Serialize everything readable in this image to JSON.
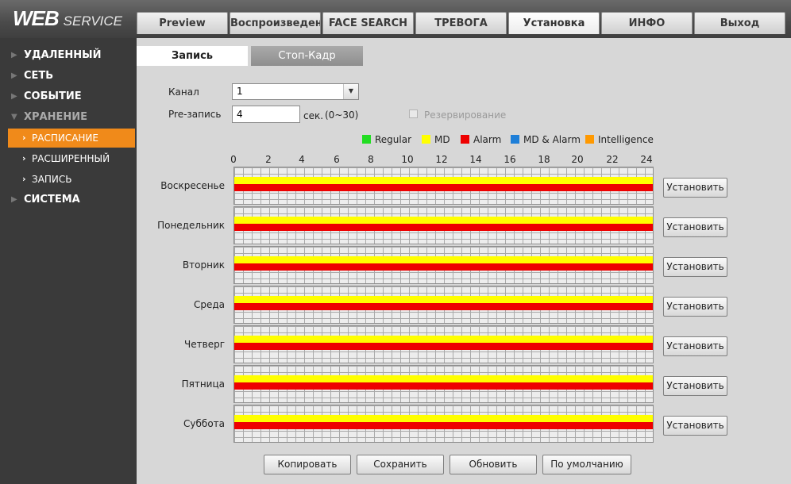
{
  "header": {
    "logo_main": "WEB",
    "logo_sub": "SERVICE",
    "tabs": [
      {
        "label": "Preview"
      },
      {
        "label": "Воспроизведение"
      },
      {
        "label": "FACE SEARCH"
      },
      {
        "label": "ТРЕВОГА"
      },
      {
        "label": "Установка"
      },
      {
        "label": "ИНФО"
      },
      {
        "label": "Выход"
      }
    ],
    "active_tab": "Установка"
  },
  "sidebar": {
    "items": [
      {
        "label": "УДАЛЕННЫЙ"
      },
      {
        "label": "СЕТЬ"
      },
      {
        "label": "СОБЫТИЕ"
      },
      {
        "label": "ХРАНЕНИЕ"
      },
      {
        "label": "СИСТЕМА"
      }
    ],
    "subitems": [
      {
        "label": "РАСПИСАНИЕ"
      },
      {
        "label": "РАСШИРЕННЫЙ"
      },
      {
        "label": "ЗАПИСЬ"
      }
    ],
    "active_subitem": "РАСПИСАНИЕ"
  },
  "subtabs": [
    {
      "label": "Запись"
    },
    {
      "label": "Стоп-Кадр"
    }
  ],
  "form": {
    "channel_label": "Канал",
    "channel_value": "1",
    "prerecord_label": "Pre-запись",
    "prerecord_value": "4",
    "prerecord_unit": "сек.",
    "prerecord_range": "(0~30)",
    "reserve_label": "Резервирование",
    "reserve_checked": false
  },
  "legend": [
    {
      "label": "Regular",
      "color": "#22dd22"
    },
    {
      "label": "MD",
      "color": "#ffff00"
    },
    {
      "label": "Alarm",
      "color": "#ee0000"
    },
    {
      "label": "MD & Alarm",
      "color": "#1e7fd8"
    },
    {
      "label": "Intelligence",
      "color": "#ff9900"
    }
  ],
  "hours": [
    "0",
    "2",
    "4",
    "6",
    "8",
    "10",
    "12",
    "14",
    "16",
    "18",
    "20",
    "22",
    "24"
  ],
  "days": [
    {
      "label": "Воскресенье",
      "md": [
        0,
        24
      ],
      "alarm": [
        0,
        24
      ]
    },
    {
      "label": "Понедельник",
      "md": [
        0,
        24
      ],
      "alarm": [
        0,
        24
      ]
    },
    {
      "label": "Вторник",
      "md": [
        0,
        24
      ],
      "alarm": [
        0,
        24
      ]
    },
    {
      "label": "Среда",
      "md": [
        0,
        24
      ],
      "alarm": [
        0,
        24
      ]
    },
    {
      "label": "Четверг",
      "md": [
        0,
        24
      ],
      "alarm": [
        0,
        24
      ]
    },
    {
      "label": "Пятница",
      "md": [
        0,
        24
      ],
      "alarm": [
        0,
        24
      ]
    },
    {
      "label": "Суббота",
      "md": [
        0,
        24
      ],
      "alarm": [
        0,
        24
      ]
    }
  ],
  "set_button_label": "Установить",
  "buttons": {
    "copy": "Копировать",
    "save": "Сохранить",
    "refresh": "Обновить",
    "default": "По умолчанию"
  }
}
